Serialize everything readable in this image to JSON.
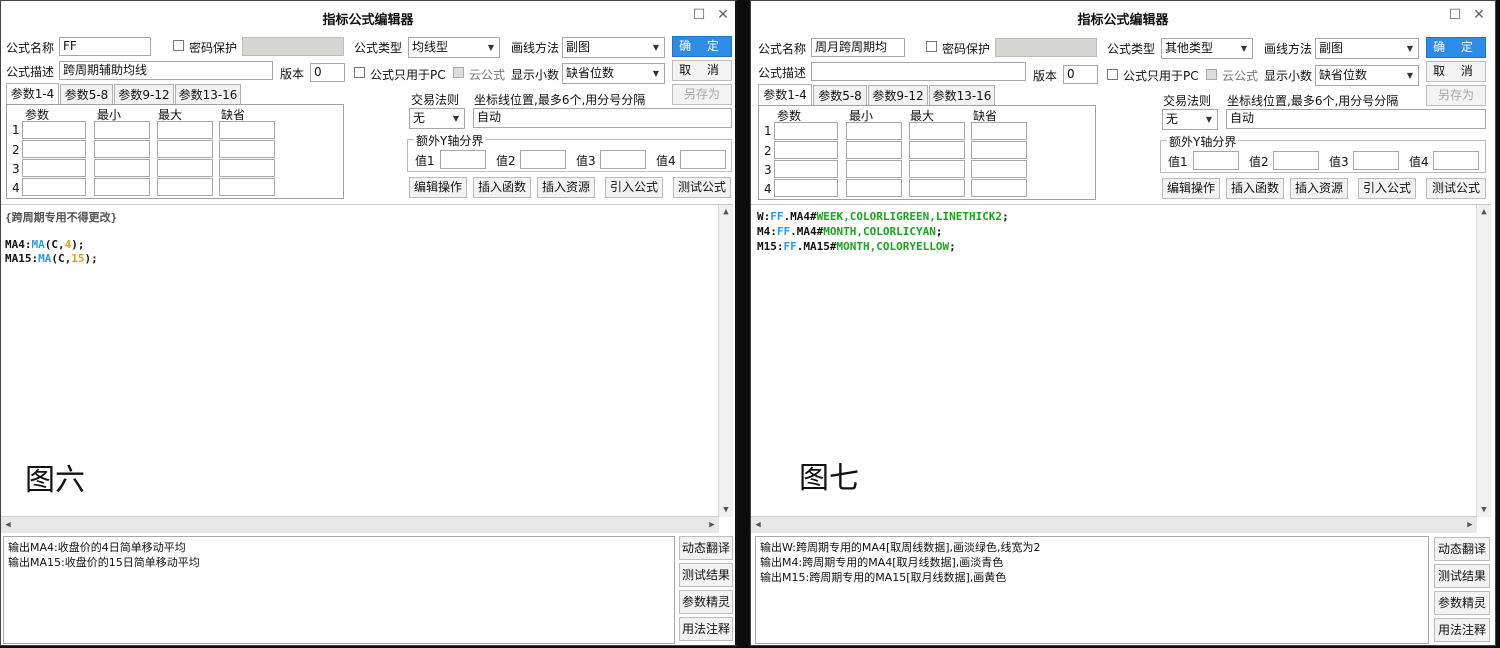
{
  "left": {
    "title": "指标公式编辑器",
    "labels": {
      "name": "公式名称",
      "password": "密码保护",
      "type": "公式类型",
      "draw": "画线方法",
      "desc": "公式描述",
      "version": "版本",
      "pc_only": "公式只用于PC",
      "cloud": "云公式",
      "decimals": "显示小数",
      "trade_rule": "交易法则",
      "axis_hint": "坐标线位置,最多6个,用分号分隔",
      "y_group": "额外Y轴分界",
      "v1": "值1",
      "v2": "值2",
      "v3": "值3",
      "v4": "值4"
    },
    "values": {
      "name": "FF",
      "type": "均线型",
      "draw": "副图",
      "desc": "跨周期辅助均线",
      "version": "0",
      "decimals": "缺省位数",
      "trade_rule": "无",
      "axis": "自动"
    },
    "buttons": {
      "ok": "确 定",
      "cancel": "取 消",
      "save_as": "另存为"
    },
    "tabs": [
      "参数1-4",
      "参数5-8",
      "参数9-12",
      "参数13-16"
    ],
    "grid_headers": [
      "参数",
      "最小",
      "最大",
      "缺省"
    ],
    "row_numbers": [
      "1",
      "2",
      "3",
      "4"
    ],
    "actions": [
      "编辑操作",
      "插入函数",
      "插入资源",
      "引入公式",
      "测试公式"
    ],
    "code": [
      [
        {
          "t": "{跨周期专用不得更改}",
          "c": "grey"
        }
      ],
      [],
      [
        {
          "t": "MA4:",
          "c": "plain"
        },
        {
          "t": "MA",
          "c": "func"
        },
        {
          "t": "(C,",
          "c": "plain"
        },
        {
          "t": "4",
          "c": "param"
        },
        {
          "t": ");",
          "c": "plain"
        }
      ],
      [
        {
          "t": "MA15:",
          "c": "plain"
        },
        {
          "t": "MA",
          "c": "func"
        },
        {
          "t": "(C,",
          "c": "plain"
        },
        {
          "t": "15",
          "c": "param"
        },
        {
          "t": ");",
          "c": "plain"
        }
      ]
    ],
    "caption": "图六",
    "output": [
      "输出MA4:收盘价的4日简单移动平均",
      "输出MA15:收盘价的15日简单移动平均"
    ],
    "side_buttons": [
      "动态翻译",
      "测试结果",
      "参数精灵",
      "用法注释"
    ]
  },
  "right": {
    "title": "指标公式编辑器",
    "labels": {
      "name": "公式名称",
      "password": "密码保护",
      "type": "公式类型",
      "draw": "画线方法",
      "desc": "公式描述",
      "version": "版本",
      "pc_only": "公式只用于PC",
      "cloud": "云公式",
      "decimals": "显示小数",
      "trade_rule": "交易法则",
      "axis_hint": "坐标线位置,最多6个,用分号分隔",
      "y_group": "额外Y轴分界",
      "v1": "值1",
      "v2": "值2",
      "v3": "值3",
      "v4": "值4"
    },
    "values": {
      "name": "周月跨周期均",
      "type": "其他类型",
      "draw": "副图",
      "desc": "",
      "version": "0",
      "decimals": "缺省位数",
      "trade_rule": "无",
      "axis": "自动"
    },
    "buttons": {
      "ok": "确 定",
      "cancel": "取 消",
      "save_as": "另存为"
    },
    "tabs": [
      "参数1-4",
      "参数5-8",
      "参数9-12",
      "参数13-16"
    ],
    "grid_headers": [
      "参数",
      "最小",
      "最大",
      "缺省"
    ],
    "row_numbers": [
      "1",
      "2",
      "3",
      "4"
    ],
    "actions": [
      "编辑操作",
      "插入函数",
      "插入资源",
      "引入公式",
      "测试公式"
    ],
    "code": [
      [
        {
          "t": "W:",
          "c": "plain"
        },
        {
          "t": "FF",
          "c": "func"
        },
        {
          "t": ".MA4#",
          "c": "plain"
        },
        {
          "t": "WEEK,COLORLIGREEN,LINETHICK2",
          "c": "green"
        },
        {
          "t": ";",
          "c": "plain"
        }
      ],
      [
        {
          "t": "M4:",
          "c": "plain"
        },
        {
          "t": "FF",
          "c": "func"
        },
        {
          "t": ".MA4#",
          "c": "plain"
        },
        {
          "t": "MONTH,COLORLICYAN",
          "c": "green"
        },
        {
          "t": ";",
          "c": "plain"
        }
      ],
      [
        {
          "t": "M15:",
          "c": "plain"
        },
        {
          "t": "FF",
          "c": "func"
        },
        {
          "t": ".MA15#",
          "c": "plain"
        },
        {
          "t": "MONTH,COLORYELLOW",
          "c": "green"
        },
        {
          "t": ";",
          "c": "plain"
        }
      ]
    ],
    "caption": "图七",
    "output": [
      "输出W:跨周期专用的MA4[取周线数据],画淡绿色,线宽为2",
      "输出M4:跨周期专用的MA4[取月线数据],画淡青色",
      "输出M15:跨周期专用的MA15[取月线数据],画黄色"
    ],
    "side_buttons": [
      "动态翻译",
      "测试结果",
      "参数精灵",
      "用法注释"
    ]
  },
  "colors": {
    "primary_button": "#2d8ce6",
    "func": "#2a9ce8",
    "param": "#e0a020",
    "keyword": "#1aa61a"
  },
  "icons": {
    "restore": "restore-window-icon",
    "close": "close-icon",
    "dropdown": "chevron-down-icon"
  }
}
